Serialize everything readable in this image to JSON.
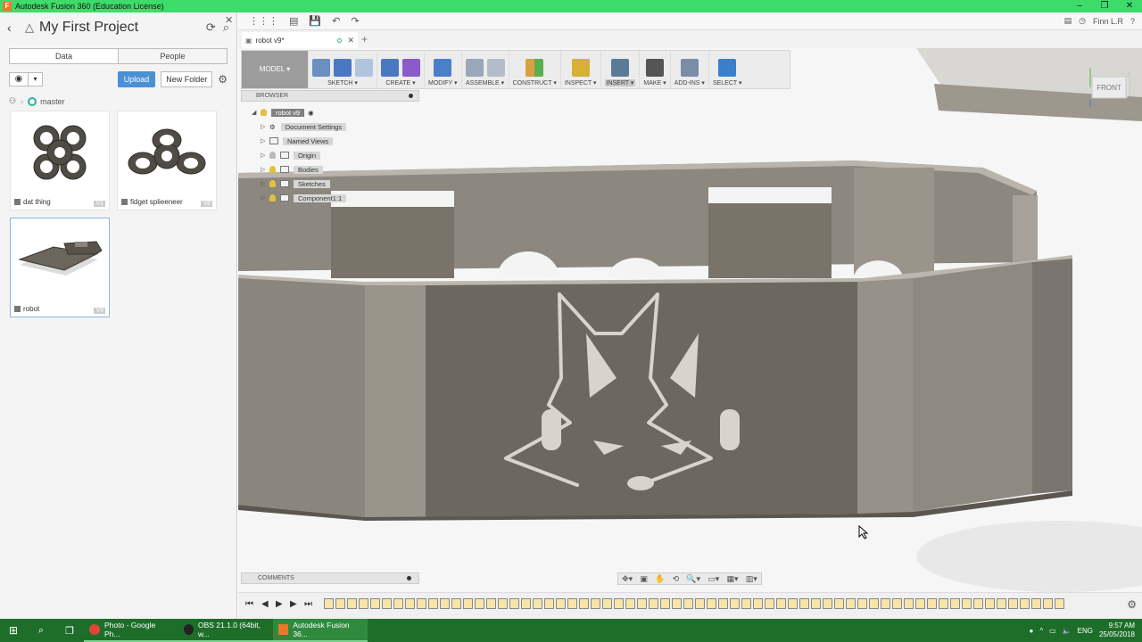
{
  "window": {
    "title": "Autodesk Fusion 360 (Education License)",
    "controls": [
      "–",
      "❐",
      "✕"
    ]
  },
  "quick_access": {
    "grid_icon": "⋮⋮⋮",
    "file_icon": "▤",
    "save_icon": "💾",
    "undo_icon": "↶",
    "redo_icon": "↷",
    "user_name": "Finn L.R",
    "help_icon": "?"
  },
  "data_panel": {
    "project_name": "My First Project",
    "tabs": [
      "Data",
      "People"
    ],
    "upload_label": "Upload",
    "new_folder_label": "New Folder",
    "branch": "master",
    "files": [
      {
        "name": "dat thing",
        "version": "V1"
      },
      {
        "name": "fidget splieeneer",
        "version": "V8"
      },
      {
        "name": "robot",
        "version": "V9"
      }
    ]
  },
  "doc_tab": {
    "name": "robot v9*",
    "add": "+"
  },
  "ribbon": {
    "mode": "MODEL ▾",
    "groups": [
      {
        "label": "SKETCH ▾"
      },
      {
        "label": "CREATE ▾"
      },
      {
        "label": "MODIFY ▾"
      },
      {
        "label": "ASSEMBLE ▾"
      },
      {
        "label": "CONSTRUCT ▾"
      },
      {
        "label": "INSPECT ▾"
      },
      {
        "label": "INSERT ▾"
      },
      {
        "label": "MAKE ▾"
      },
      {
        "label": "ADD-INS ▾"
      },
      {
        "label": "SELECT ▾"
      }
    ],
    "colors": {
      "sketch": "#6a8fc0",
      "create": "#4a78c2",
      "create_accent": "#8a5bc9",
      "modify": "#4a7fc9",
      "assemble": "#9aa7b8",
      "construct": "#d8a040",
      "construct_accent": "#5ab04d",
      "inspect": "#d8b035",
      "insert": "#5a7a98",
      "make": "#555555",
      "addins": "#7a8da6",
      "select": "#3a7fc9"
    }
  },
  "browser": {
    "header": "BROWSER",
    "root": "robot v9",
    "items": [
      "Document Settings",
      "Named Views",
      "Origin",
      "Bodies",
      "Sketches",
      "Component1:1"
    ]
  },
  "viewcube": {
    "face": "FRONT"
  },
  "comments": {
    "label": "COMMENTS"
  },
  "navbar": {
    "icons": [
      "✥▾",
      "▣",
      "✋",
      "⟲",
      "🔍▾",
      "▭▾",
      "▦▾",
      "▥▾"
    ]
  },
  "timeline": {
    "controls": [
      "⏮",
      "◀",
      "▶",
      "▶",
      "⏭"
    ]
  },
  "taskbar": {
    "apps": [
      {
        "label": "Photo - Google Ph...",
        "color": "#e0453a"
      },
      {
        "label": "OBS 21.1.0 (64bit, w...",
        "color": "#222222"
      },
      {
        "label": "Autodesk Fusion 36...",
        "color": "#e8792c"
      }
    ],
    "lang": "ENG",
    "time": "9:57 AM",
    "date": "25/05/2018"
  }
}
